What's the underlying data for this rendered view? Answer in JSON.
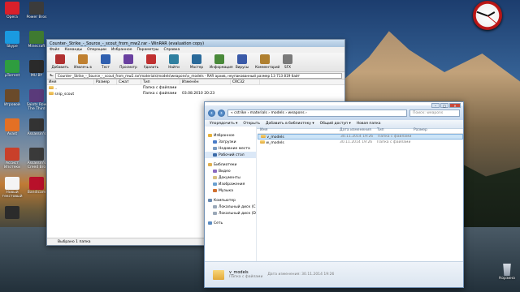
{
  "desktop": {
    "icons": [
      {
        "label": "Opera",
        "color": "#d9202a"
      },
      {
        "label": "Power Bros",
        "color": "#3b3b3b"
      },
      {
        "label": "Skype",
        "color": "#1a9ae0"
      },
      {
        "label": "Minecraft",
        "color": "#3f7a31"
      },
      {
        "label": "µTorrent",
        "color": "#2e9d3f"
      },
      {
        "label": "MU BY",
        "color": "#2a2a2a"
      },
      {
        "label": "Игровой",
        "color": "#6a4a2a"
      },
      {
        "label": "Saints Row The Third",
        "color": "#5a3a7a"
      },
      {
        "label": "Avast",
        "color": "#e47024"
      },
      {
        "label": "Assassin's",
        "color": "#333333"
      },
      {
        "label": "Ассист Ипотеки",
        "color": "#c9402a"
      },
      {
        "label": "Assassin's Creed Bro",
        "color": "#3a3a3a"
      },
      {
        "label": "Новый текстовый",
        "color": "#f4f4f4"
      },
      {
        "label": "Bandicam",
        "color": "#b8102a"
      },
      {
        "label": "",
        "color": "#2b2b2b"
      }
    ],
    "recycle_bin_label": "Корзина"
  },
  "winrar": {
    "title": "Counter-_Strike_-_Source_-_scout_from_mw2.rar - WinRAR (evaluation copy)",
    "menu": [
      "Файл",
      "Команды",
      "Операции",
      "Избранное",
      "Параметры",
      "Справка"
    ],
    "toolbar": [
      "Добавить",
      "Извлечь в",
      "Тест",
      "Просмотр",
      "Удалить",
      "Найти",
      "Мастер",
      "Информация",
      "Вирусы",
      "Комментарий",
      "SFX"
    ],
    "path": "Counter-_Strike_-_Source_-_scout_from_mw2.rar\\materials\\models\\weapons\\v_models - RAR архив, неупакованный размер 13 713 819 байт",
    "columns": [
      "Имя",
      "Размер",
      "Сжат",
      "Тип",
      "Изменён",
      "CRC32"
    ],
    "rows": [
      {
        "name": "..",
        "size": "",
        "packed": "",
        "type": "Папка с файлами",
        "modified": "",
        "crc": ""
      },
      {
        "name": "snip_scout",
        "size": "",
        "packed": "",
        "type": "Папка с файлами",
        "modified": "03.08.2010 20:23",
        "crc": ""
      }
    ],
    "status": "Выбрано 1 папка"
  },
  "explorer": {
    "breadcrumb": "« cstrike › materials › models › weapons ›",
    "search_placeholder": "Поиск: weapons",
    "commands": [
      "Упорядочить ▾",
      "Открыть",
      "Добавить в библиотеку ▾",
      "Общий доступ ▾",
      "Новая папка"
    ],
    "nav": [
      {
        "label": "Избранное",
        "head": true,
        "color": "#e8b23a"
      },
      {
        "label": "Загрузки",
        "head": false,
        "color": "#4a7cc8"
      },
      {
        "label": "Недавние места",
        "head": false,
        "color": "#7a9ac0"
      },
      {
        "label": "Рабочий стол",
        "head": false,
        "color": "#3a6aa8",
        "selected": true
      },
      {
        "label": "Библиотеки",
        "head": true,
        "color": "#e0b050"
      },
      {
        "label": "Видео",
        "head": false,
        "color": "#8a6ac0"
      },
      {
        "label": "Документы",
        "head": false,
        "color": "#d8c080"
      },
      {
        "label": "Изображения",
        "head": false,
        "color": "#6aa0d0"
      },
      {
        "label": "Музыка",
        "head": false,
        "color": "#d07030"
      },
      {
        "label": "Компьютер",
        "head": true,
        "color": "#6a8ab0"
      },
      {
        "label": "Локальный диск (C:)",
        "head": false,
        "color": "#9aa8b8"
      },
      {
        "label": "Локальный диск (D:)",
        "head": false,
        "color": "#9aa8b8"
      },
      {
        "label": "Сеть",
        "head": true,
        "color": "#5a8ac0"
      }
    ],
    "columns": [
      "Имя",
      "Дата изменения",
      "Тип",
      "Размер"
    ],
    "rows": [
      {
        "name": "v_models",
        "date": "30.11.2014 19:26",
        "type": "Папка с файлами",
        "size": "",
        "selected": true
      },
      {
        "name": "w_models",
        "date": "30.11.2014 19:26",
        "type": "Папка с файлами",
        "size": ""
      }
    ],
    "details_name": "v_models",
    "details_info": "Дата изменения: 30.11.2014 19:26",
    "details_type": "Папка с файлами"
  }
}
